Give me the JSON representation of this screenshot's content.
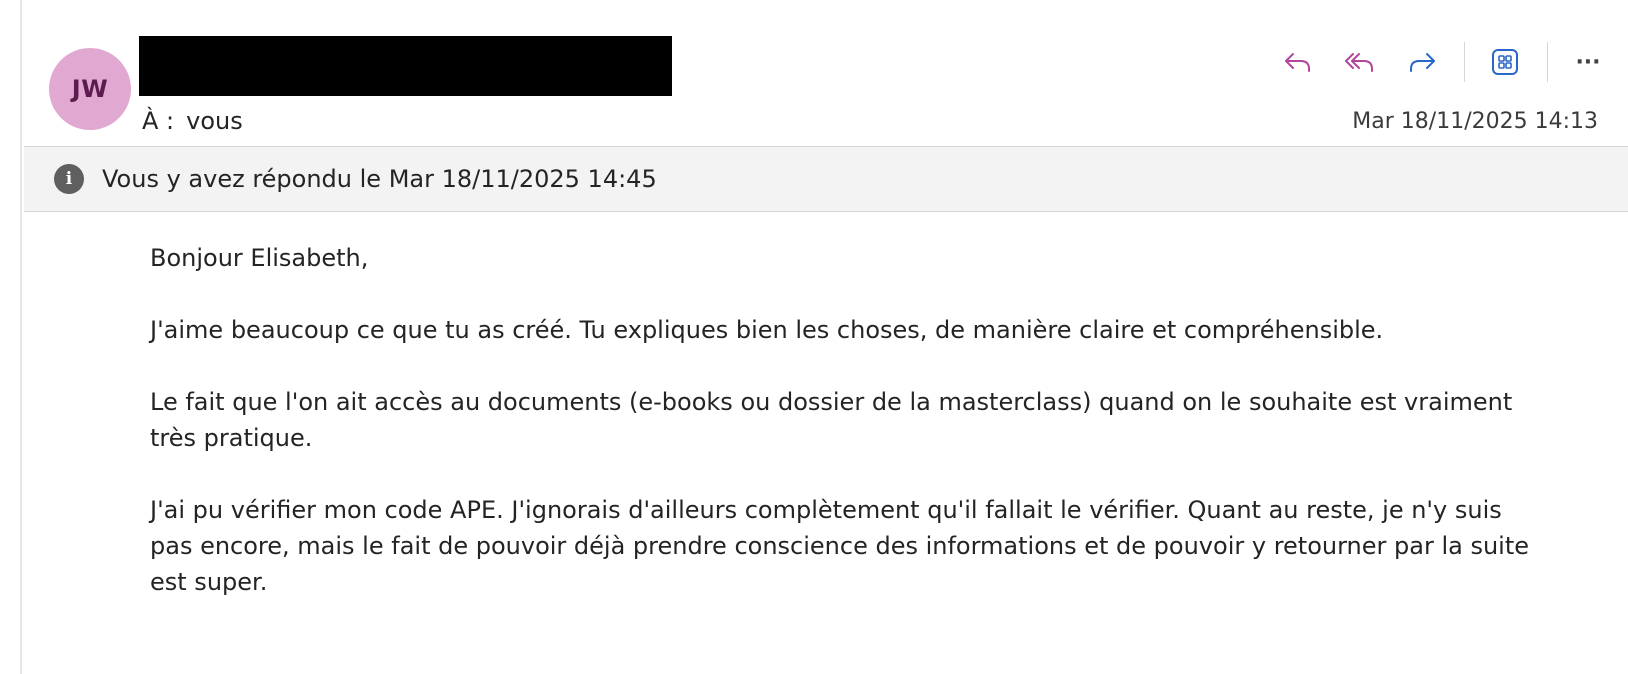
{
  "sender": {
    "initials": "JW",
    "name_redacted": true
  },
  "recipient": {
    "to_label": "À :",
    "to_value": "vous"
  },
  "date": "Mar 18/11/2025 14:13",
  "actions": {
    "reply_icon": "reply-icon",
    "reply_all_icon": "reply-all-icon",
    "forward_icon": "forward-icon",
    "apps_icon": "apps-icon",
    "more_label": "···"
  },
  "info_bar": {
    "icon": "info-icon",
    "icon_glyph": "i",
    "text": "Vous y avez répondu le Mar 18/11/2025 14:45"
  },
  "body": {
    "greeting": "Bonjour Elisabeth,",
    "paragraphs": [
      "J'aime beaucoup ce que tu as créé. Tu expliques bien les choses, de manière claire et compréhensible.",
      "Le fait que l'on ait accès au documents (e-books ou dossier de la masterclass) quand on le souhaite est vraiment très pratique.",
      "J'ai pu vérifier mon code APE. J'ignorais d'ailleurs complètement qu'il fallait le vérifier. Quant au reste, je n'y suis pas encore, mais le fait de pouvoir déjà prendre conscience des informations et de pouvoir y retourner par la suite est super."
    ]
  },
  "colors": {
    "avatar_bg": "#e1a9d2",
    "avatar_text": "#5c1d4e",
    "reply_icon_color": "#b3469a",
    "forward_icon_color": "#2b66c9",
    "info_bar_bg": "#f3f3f3"
  }
}
